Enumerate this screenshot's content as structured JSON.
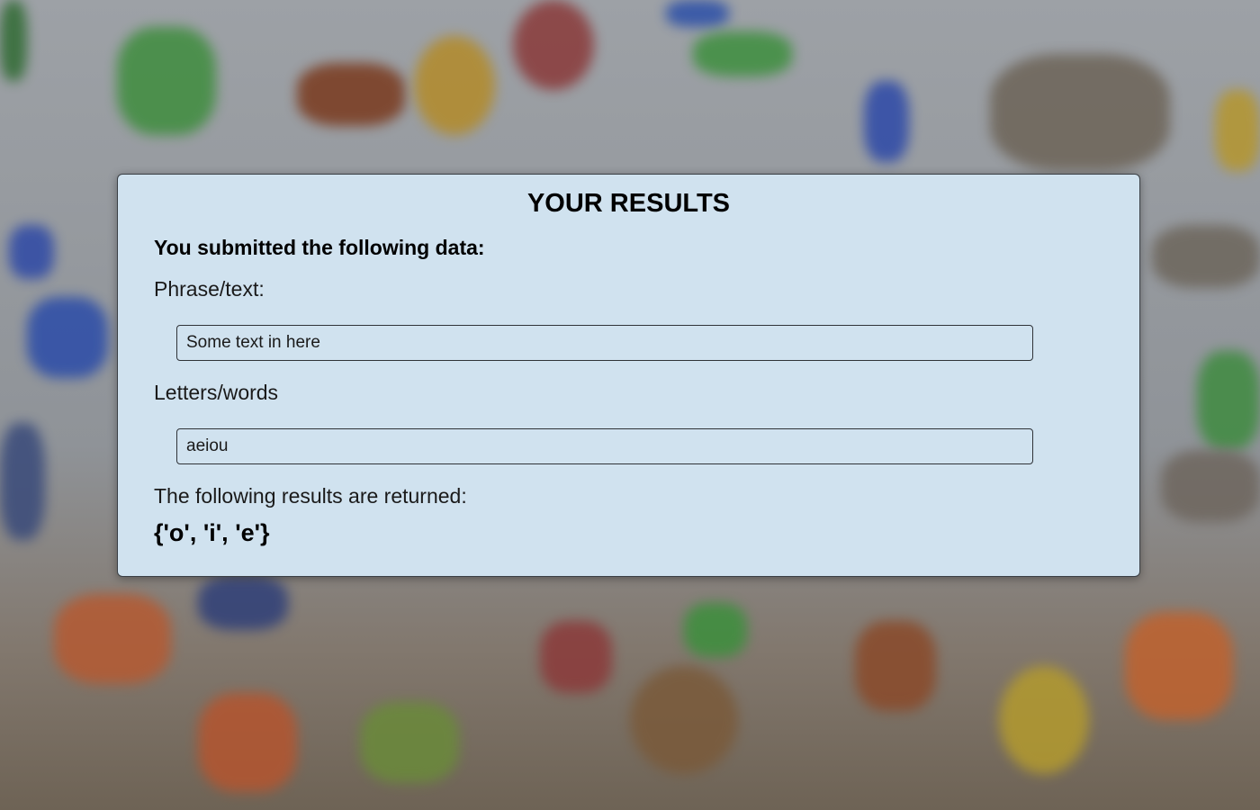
{
  "card": {
    "title": "YOUR RESULTS",
    "subheading": "You submitted the following data:",
    "phrase": {
      "label": "Phrase/text:",
      "value": "Some text in here"
    },
    "letters": {
      "label": "Letters/words",
      "value": "aeiou"
    },
    "results_label": "The following results are returned:",
    "results_value": "{'o', 'i', 'e'}"
  },
  "colors": {
    "card_background": "#d0e2ef",
    "card_border": "#3a3f45",
    "text": "#000000"
  }
}
